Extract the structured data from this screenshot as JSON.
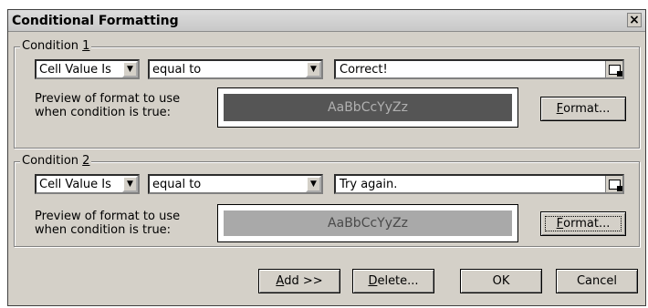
{
  "window": {
    "title": "Conditional Formatting",
    "close_label": "×"
  },
  "condition1": {
    "legend_prefix": "Condition ",
    "legend_accel": "1",
    "type_value": "Cell Value Is",
    "operator_value": "equal to",
    "value": "Correct!",
    "preview_label_line1": "Preview of format to use",
    "preview_label_line2": "when condition is true:",
    "preview_text": "AaBbCcYyZz",
    "preview_bg": "#555555",
    "format_accel": "F",
    "format_rest": "ormat..."
  },
  "condition2": {
    "legend_prefix": "Condition ",
    "legend_accel": "2",
    "type_value": "Cell Value Is",
    "operator_value": "equal to",
    "value": "Try again.",
    "preview_label_line1": "Preview of format to use",
    "preview_label_line2": "when condition is true:",
    "preview_text": "AaBbCcYyZz",
    "preview_bg": "#a9a9a9",
    "format_accel": "F",
    "format_rest": "ormat..."
  },
  "footer": {
    "add_accel": "A",
    "add_rest": "dd >>",
    "delete_accel": "D",
    "delete_rest": "elete...",
    "ok_label": "OK",
    "cancel_label": "Cancel"
  }
}
